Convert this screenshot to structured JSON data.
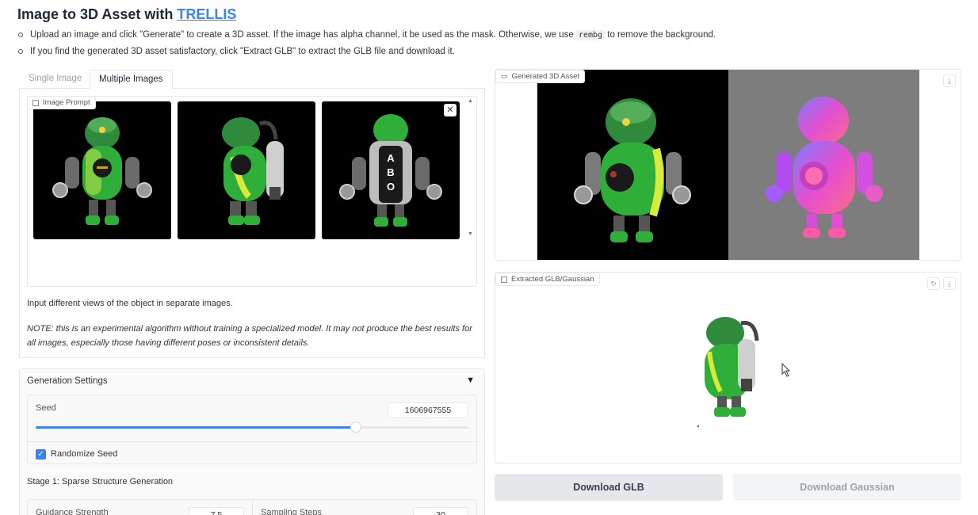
{
  "header": {
    "title_prefix": "Image to 3D Asset with ",
    "title_link": "TRELLIS",
    "bullet1_a": "Upload an image and click \"Generate\" to create a 3D asset. If the image has alpha channel, it be used as the mask. Otherwise, we use ",
    "bullet1_code": "rembg",
    "bullet1_b": " to remove the background.",
    "bullet2": "If you find the generated 3D asset satisfactory, click \"Extract GLB\" to extract the GLB file and download it."
  },
  "tabs": [
    {
      "label": "Single Image",
      "active": false
    },
    {
      "label": "Multiple Images",
      "active": true
    }
  ],
  "gallery": {
    "label": "Image Prompt",
    "images": [
      "robot-front-view",
      "robot-side-view",
      "robot-back-view"
    ]
  },
  "descriptions": {
    "input_hint": "Input different views of the object in separate images.",
    "note": "NOTE: this is an experimental algorithm without training a specialized model. It may not produce the best results for all images, especially those having different poses or inconsistent details."
  },
  "generation_settings": {
    "title": "Generation Settings",
    "seed_label": "Seed",
    "seed_value": "1606967555",
    "seed_slider_fraction": 0.74,
    "randomize_label": "Randomize Seed",
    "randomize_checked": true,
    "stage1_title": "Stage 1: Sparse Structure Generation",
    "guidance_label": "Guidance Strength",
    "guidance_value": "7.5",
    "steps_label": "Sampling Steps",
    "steps_value": "30"
  },
  "output": {
    "generated_label": "Generated 3D Asset",
    "extracted_label": "Extracted GLB/Gaussian"
  },
  "buttons": {
    "download_glb": "Download GLB",
    "download_gaussian": "Download Gaussian"
  },
  "colors": {
    "accent": "#3b82f6",
    "robot_green": "#2fae3a",
    "normal_pink": "#e24fd0"
  }
}
